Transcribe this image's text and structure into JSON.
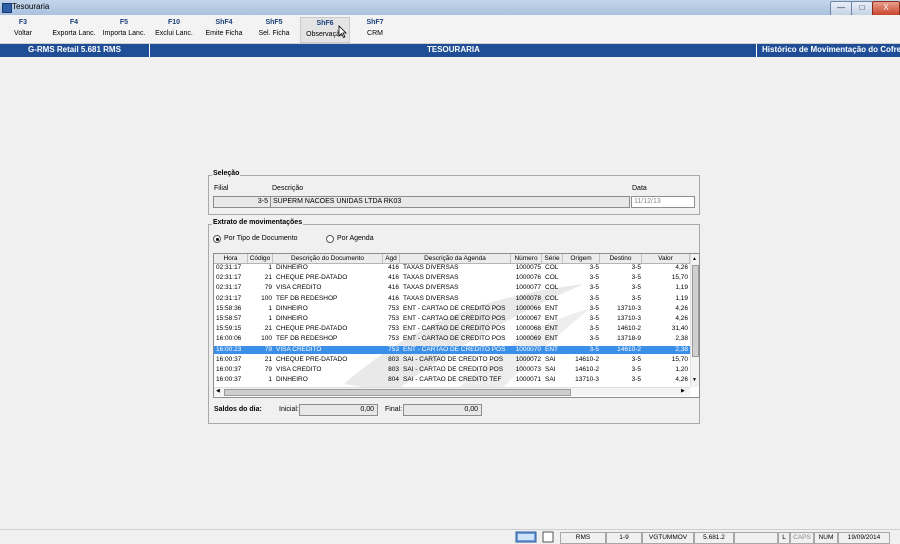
{
  "window": {
    "title": "Tesouraria",
    "minimize": "—",
    "maximize": "□",
    "close": "X"
  },
  "toolbar": [
    {
      "key": "F3",
      "label": "Voltar"
    },
    {
      "key": "F4",
      "label": "Exporta Lanc."
    },
    {
      "key": "F5",
      "label": "Importa Lanc."
    },
    {
      "key": "F10",
      "label": "Exclui Lanc."
    },
    {
      "key": "ShF4",
      "label": "Emite Ficha"
    },
    {
      "key": "ShF5",
      "label": "Sel. Ficha"
    },
    {
      "key": "ShF6",
      "label": "Observação"
    },
    {
      "key": "ShF7",
      "label": "CRM"
    }
  ],
  "header": {
    "app": "G-RMS Retail 5.681 RMS",
    "module": "TESOURARIA",
    "screen": "Histórico de Movimentação do Cofre"
  },
  "selecao": {
    "title": "Seleção",
    "filial_label": "Filial",
    "filial_value": "3-5",
    "descricao_label": "Descrição",
    "descricao_value": "SUPERM NACOES UNIDAS LTDA RK03",
    "data_label": "Data",
    "data_value": "11/12/13"
  },
  "extrato": {
    "title": "Extrato de movimentações",
    "radio1": "Por Tipo de Documento",
    "radio2": "Por Agenda",
    "columns": [
      "Hora",
      "Código",
      "Descrição do Documento",
      "Agd",
      "Descrição da Agenda",
      "Número",
      "Série",
      "Origem",
      "Destino",
      "Valor"
    ],
    "rows": [
      [
        "02:31:17",
        "1",
        "DINHEIRO",
        "416",
        "TAXAS DIVERSAS",
        "1000075",
        "COL",
        "3-5",
        "3-5",
        "4,26"
      ],
      [
        "02:31:17",
        "21",
        "CHEQUE PRE-DATADO",
        "416",
        "TAXAS DIVERSAS",
        "1000076",
        "COL",
        "3-5",
        "3-5",
        "15,70"
      ],
      [
        "02:31:17",
        "79",
        "VISA CREDITO",
        "416",
        "TAXAS DIVERSAS",
        "1000077",
        "COL",
        "3-5",
        "3-5",
        "1,19"
      ],
      [
        "02:31:17",
        "100",
        "TEF DB REDESHOP",
        "416",
        "TAXAS DIVERSAS",
        "1000078",
        "COL",
        "3-5",
        "3-5",
        "1,19"
      ],
      [
        "15:58:36",
        "1",
        "DINHEIRO",
        "753",
        "ENT - CARTAO DE CREDITO POS",
        "1000066",
        "ENT",
        "3-5",
        "13710-3",
        "4,26"
      ],
      [
        "15:58:57",
        "1",
        "DINHEIRO",
        "753",
        "ENT - CARTAO DE CREDITO POS",
        "1000067",
        "ENT",
        "3-5",
        "13710-3",
        "4,26"
      ],
      [
        "15:59:15",
        "21",
        "CHEQUE PRE-DATADO",
        "753",
        "ENT - CARTAO DE CREDITO POS",
        "1000068",
        "ENT",
        "3-5",
        "14610-2",
        "31,40"
      ],
      [
        "16:00:06",
        "100",
        "TEF DB REDESHOP",
        "753",
        "ENT - CARTAO DE CREDITO POS",
        "1000069",
        "ENT",
        "3-5",
        "13718-9",
        "2,38"
      ],
      [
        "16:00:23",
        "79",
        "VISA CREDITO",
        "753",
        "ENT - CARTAO DE CREDITO POS",
        "1000070",
        "ENT",
        "3-5",
        "14610-2",
        "2,38"
      ],
      [
        "16:00:37",
        "21",
        "CHEQUE PRE-DATADO",
        "803",
        "SAI - CARTAO DE CREDITO POS",
        "1000072",
        "SAI",
        "14610-2",
        "3-5",
        "15,70"
      ],
      [
        "16:00:37",
        "79",
        "VISA CREDITO",
        "803",
        "SAI - CARTAO DE CREDITO POS",
        "1000073",
        "SAI",
        "14610-2",
        "3-5",
        "1,20"
      ],
      [
        "16:00:37",
        "1",
        "DINHEIRO",
        "804",
        "SAI - CARTAO DE CREDITO TEF",
        "1000071",
        "SAI",
        "13710-3",
        "3-5",
        "4,26"
      ]
    ],
    "selected_row": 8
  },
  "saldos": {
    "label": "Saldos do dia:",
    "inicial_label": "Inicial:",
    "inicial_value": "0,00",
    "final_label": "Final:",
    "final_value": "0,00"
  },
  "statusbar": {
    "user_sys": "RMS",
    "range": "1-9",
    "user": "VGTUMMOV",
    "version": "5.681.2",
    "l": "L",
    "caps": "CAPS",
    "num": "NUM",
    "date": "19/09/2014"
  }
}
